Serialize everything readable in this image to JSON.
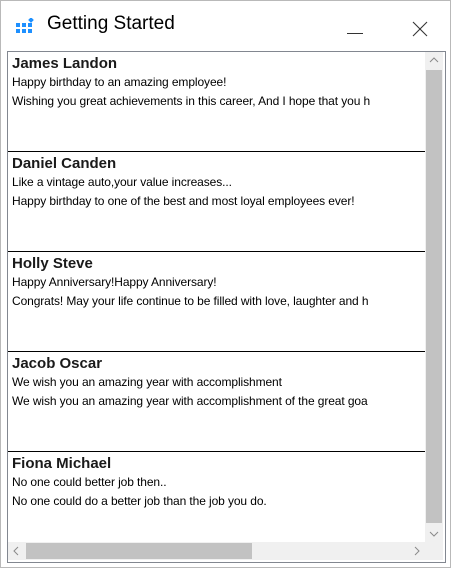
{
  "window": {
    "title": "Getting Started",
    "icon": "app-grid-icon",
    "accent": "#1e90ff"
  },
  "items": [
    {
      "name": "James Landon",
      "line1": "Happy birthday to an amazing employee!",
      "line2": "Wishing you great achievements in this career, And I hope that you h"
    },
    {
      "name": "Daniel Canden",
      "line1": "Like a vintage auto,your value increases...",
      "line2": "Happy birthday to one of the best and most loyal employees ever!"
    },
    {
      "name": "Holly Steve",
      "line1": "Happy Anniversary!Happy Anniversary!",
      "line2": "Congrats! May your life continue to be filled with love, laughter and h"
    },
    {
      "name": "Jacob Oscar",
      "line1": "We wish you an amazing year with accomplishment",
      "line2": "We wish you an amazing year with accomplishment of the great goa"
    },
    {
      "name": "Fiona Michael",
      "line1": "No one could better job then..",
      "line2": "No one could do a better job than the job you do."
    }
  ]
}
